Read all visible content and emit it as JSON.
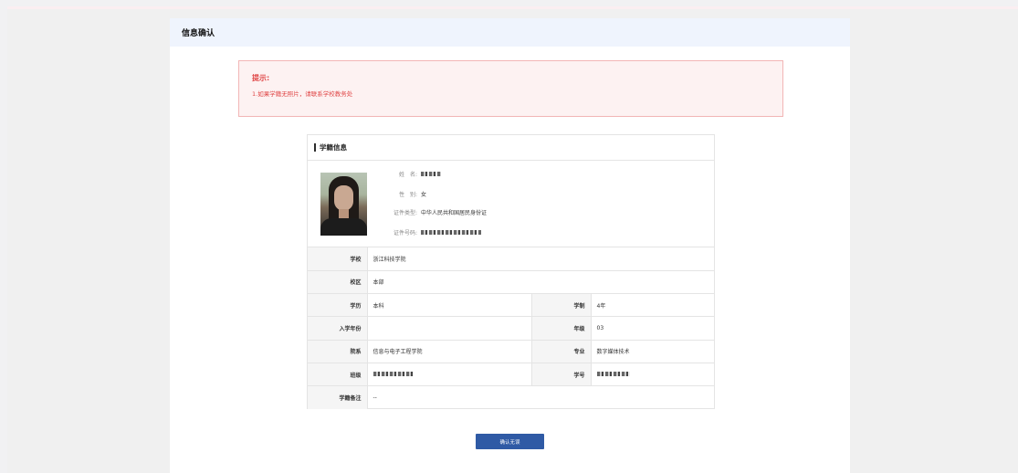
{
  "header": {
    "title": "信息确认"
  },
  "notice": {
    "title": "提示:",
    "text": "1.如果学籍无照片，请联系学校教务处"
  },
  "panel": {
    "title": "学籍信息",
    "profile": {
      "name_label": "姓　名:",
      "gender_label": "性　别:",
      "gender_value": "女",
      "id_type_label": "证件类型:",
      "id_type_value": "中华人民共和国居民身份证",
      "id_number_label": "证件号码:"
    },
    "rows": {
      "school_label": "学校",
      "school_value": "浙江科技学院",
      "campus_label": "校区",
      "campus_value": "本部",
      "degree_label": "学历",
      "degree_value": "本科",
      "duration_label": "学制",
      "duration_value": "4年",
      "enroll_label": "入学年份",
      "enroll_value": "",
      "grade_label": "年级",
      "grade_value": "03",
      "dept_label": "院系",
      "dept_value": "信息与电子工程学院",
      "major_label": "专业",
      "major_value": "数字媒体技术",
      "class_label": "班级",
      "student_id_label": "学号",
      "remark_label": "学籍备注",
      "remark_value": "--"
    }
  },
  "confirm_button": "确认无误",
  "colors": {
    "accent": "#2f5aa5",
    "notice": "#e04848",
    "header_bg": "#eff4fd"
  }
}
